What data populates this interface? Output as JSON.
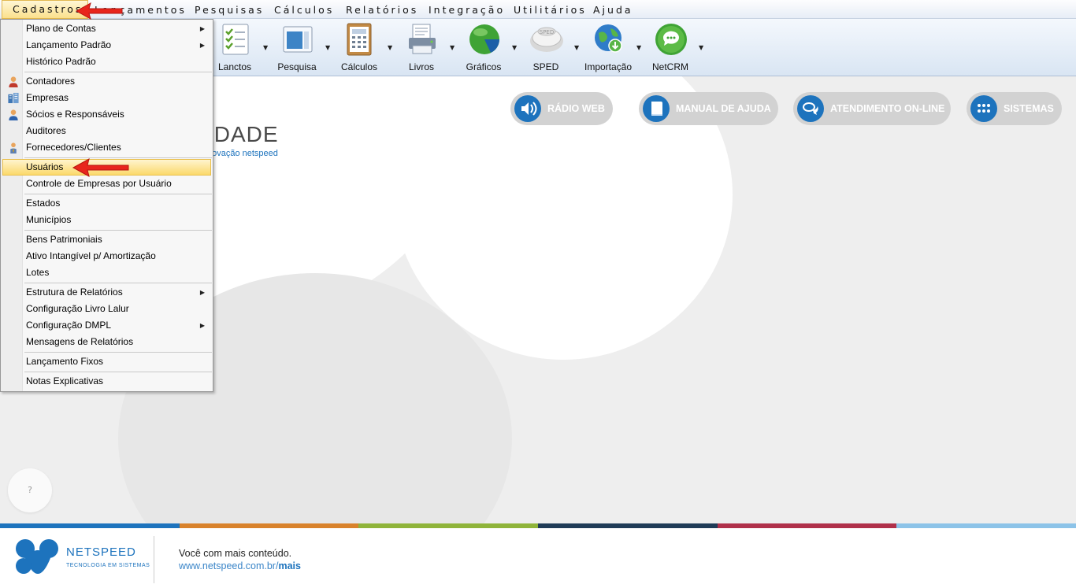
{
  "menubar": {
    "items": [
      {
        "label": "Cadastros",
        "active": true
      },
      {
        "label": "Lançamentos"
      },
      {
        "label": "Pesquisas"
      },
      {
        "label": "Cálculos"
      },
      {
        "label": "Relatórios"
      },
      {
        "label": "Integração"
      },
      {
        "label": "Utilitários"
      },
      {
        "label": "Ajuda"
      }
    ]
  },
  "toolbar": {
    "buttons": [
      {
        "label": "Lanctos",
        "icon": "checklist-icon"
      },
      {
        "label": "Pesquisa",
        "icon": "window-icon"
      },
      {
        "label": "Cálculos",
        "icon": "calculator-icon"
      },
      {
        "label": "Livros",
        "icon": "printer-icon"
      },
      {
        "label": "Gráficos",
        "icon": "pie-chart-icon"
      },
      {
        "label": "SPED",
        "icon": "sped-icon"
      },
      {
        "label": "Importação",
        "icon": "globe-download-icon"
      },
      {
        "label": "NetCRM",
        "icon": "chat-bubble-icon"
      }
    ],
    "sped_badge": "SPED"
  },
  "dropdown": {
    "items": [
      {
        "label": "Plano de Contas",
        "submenu": true
      },
      {
        "label": "Lançamento Padrão",
        "submenu": true
      },
      {
        "label": "Histórico Padrão"
      },
      {
        "label": "Contadores",
        "icon": "person-icon"
      },
      {
        "label": "Empresas",
        "icon": "buildings-icon"
      },
      {
        "label": "Sócios e Responsáveis",
        "icon": "person-icon"
      },
      {
        "label": "Auditores"
      },
      {
        "label": "Fornecedores/Clientes",
        "icon": "person-tie-icon"
      },
      {
        "label": "Usuários",
        "highlighted": true
      },
      {
        "label": "Controle de Empresas por Usuário"
      },
      {
        "label": "Estados"
      },
      {
        "label": "Municípios"
      },
      {
        "label": "Bens Patrimoniais"
      },
      {
        "label": "Ativo Intangível p/ Amortização"
      },
      {
        "label": "Lotes"
      },
      {
        "label": "Estrutura de Relatórios",
        "submenu": true
      },
      {
        "label": "Configuração Livro Lalur"
      },
      {
        "label": "Configuração DMPL",
        "submenu": true
      },
      {
        "label": "Mensagens de Relatórios"
      },
      {
        "label": "Lançamento Fixos"
      },
      {
        "label": "Notas Explicativas"
      }
    ],
    "submenu_glyph": "▶"
  },
  "links": {
    "radio": "RÁDIO WEB",
    "manual": "MANUAL DE AJUDA",
    "atendimento": "ATENDIMENTO ON-LINE",
    "sistemas": "SISTEMAS"
  },
  "brand": {
    "headline": "IDADE",
    "sub": "novação netspeed"
  },
  "help": {
    "label": "?"
  },
  "footer": {
    "company": "NETSPEED",
    "tagline": "TECNOLOGIA EM SISTEMAS",
    "line1": "Você com mais conteúdo.",
    "url": "www.netspeed.com.br/",
    "url_bold": "mais"
  },
  "colors": {
    "accent": "#1d73bd",
    "band": [
      "#1d73bd",
      "#d9822b",
      "#8fb43a",
      "#1f3b57",
      "#b0304a",
      "#8cc3e8"
    ]
  }
}
